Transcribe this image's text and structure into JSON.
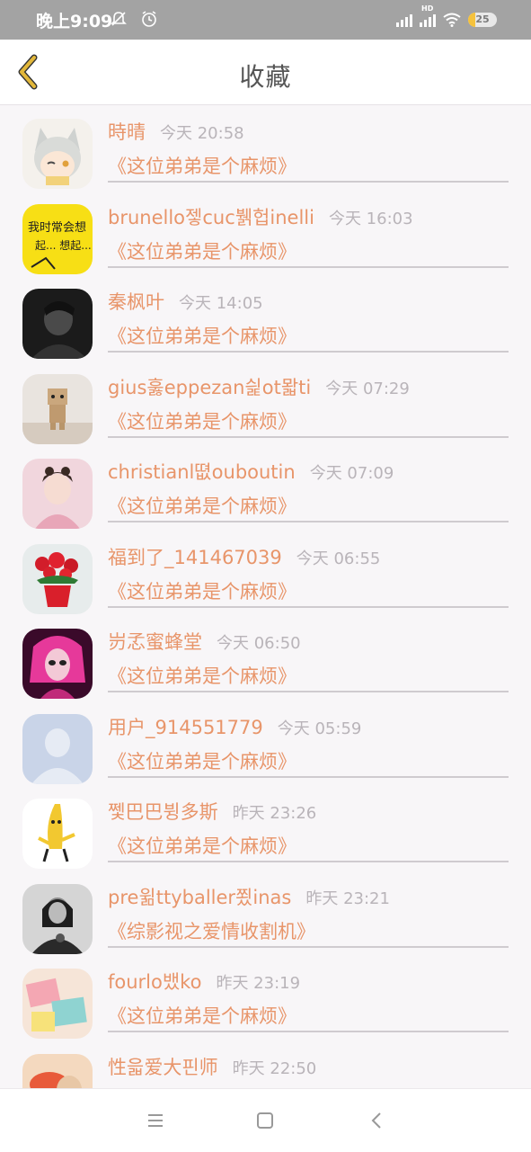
{
  "status_bar": {
    "time": "晚上9:09",
    "battery": "25",
    "battery_level_percent": 25,
    "hd_label": "HD",
    "icons": [
      "notifications-off-icon",
      "alarm-icon",
      "signal-icon",
      "hd-signal-icon",
      "wifi-icon",
      "battery-icon"
    ]
  },
  "header": {
    "title": "收藏",
    "back_icon": "chevron-left-icon"
  },
  "favorites": [
    {
      "name": "時晴",
      "time": "今天 20:58",
      "book": "《这位弟弟是个麻烦》",
      "avatar": "anime-catgirl"
    },
    {
      "name": "brunello젷cuc뷁헙inelli",
      "time": "今天 16:03",
      "book": "《这位弟弟是个麻烦》",
      "avatar": "yellow-note"
    },
    {
      "name": "秦枫叶",
      "time": "今天 14:05",
      "book": "《这位弟弟是个麻烦》",
      "avatar": "dark-portrait"
    },
    {
      "name": "gius훓eppezan싍ot뫏ti",
      "time": "今天 07:29",
      "book": "《这位弟弟是个麻烦》",
      "avatar": "danbo-figure"
    },
    {
      "name": "christianl뗪ouboutin",
      "time": "今天 07:09",
      "book": "《这位弟弟是个麻烦》",
      "avatar": "pink-girl"
    },
    {
      "name": "福到了_141467039",
      "time": "今天 06:55",
      "book": "《这位弟弟是个麻烦》",
      "avatar": "red-flowers"
    },
    {
      "name": "岃孞蜜蜂堂",
      "time": "今天 06:50",
      "book": "《这位弟弟是个麻烦》",
      "avatar": "pink-doll"
    },
    {
      "name": "用户_914551779",
      "time": "今天 05:59",
      "book": "《这位弟弟是个麻烦》",
      "avatar": "default-user"
    },
    {
      "name": "쩿巴巴뷩多斯",
      "time": "昨天 23:26",
      "book": "《这位弟弟是个麻烦》",
      "avatar": "banana"
    },
    {
      "name": "pre윎ttyballer쬤inas",
      "time": "昨天 23:21",
      "book": "《综影视之爱情收割机》",
      "avatar": "bw-girl"
    },
    {
      "name": "fourlo뱄ko",
      "time": "昨天 23:19",
      "book": "《这位弟弟是个麻烦》",
      "avatar": "pastel-boxes"
    },
    {
      "name": "性읇爱大핀师",
      "time": "昨天 22:50",
      "book": "",
      "avatar": "orange-portrait"
    }
  ],
  "nav_bar": {
    "icons": [
      "menu-icon",
      "home-icon",
      "back-icon"
    ]
  },
  "colors": {
    "accent": "#e8956a",
    "status_bar": "#a3a3a3",
    "back_arrow": "#e2b73a"
  }
}
